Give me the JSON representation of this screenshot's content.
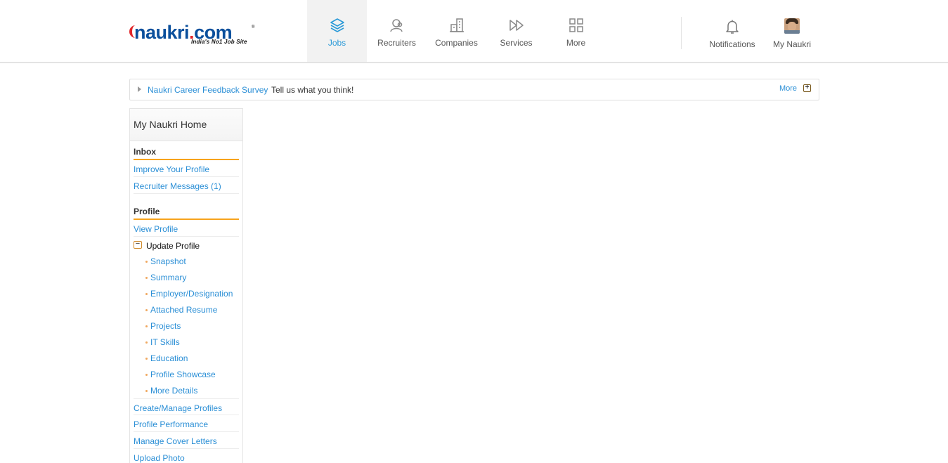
{
  "header": {
    "logo": {
      "name": "naukri",
      "dot": ".",
      "tld": "com",
      "tagline": "India's No1 Job Site",
      "reg": "®"
    },
    "nav": [
      {
        "label": "Jobs",
        "icon": "layers-icon",
        "active": true
      },
      {
        "label": "Recruiters",
        "icon": "recruiters-icon"
      },
      {
        "label": "Companies",
        "icon": "buildings-icon"
      },
      {
        "label": "Services",
        "icon": "fast-forward-icon"
      },
      {
        "label": "More",
        "icon": "grid-icon"
      }
    ],
    "notifications": {
      "label": "Notifications",
      "icon": "bell-icon"
    },
    "my_naukri": {
      "label": "My Naukri",
      "icon": "avatar"
    }
  },
  "survey": {
    "link": "Naukri Career Feedback Survey",
    "text": "Tell us what you think!",
    "more": "More",
    "plus": "+"
  },
  "sidebar": {
    "title": "My Naukri Home",
    "inbox": {
      "heading": "Inbox",
      "links": [
        "Improve Your Profile",
        "Recruiter Messages (1)"
      ]
    },
    "profile": {
      "heading": "Profile",
      "view": "View Profile",
      "update": {
        "toggle": "−",
        "label": "Update Profile"
      },
      "sub_links": [
        "Snapshot",
        "Summary",
        "Employer/Designation",
        "Attached Resume",
        "Projects",
        "IT Skills",
        "Education",
        "Profile Showcase",
        "More Details"
      ],
      "more_links": [
        "Create/Manage Profiles",
        "Profile Performance",
        "Manage Cover Letters",
        "Upload Photo"
      ]
    }
  },
  "colors": {
    "accent": "#2b9ad8",
    "link": "#2b8fd6",
    "section_rule": "#f7a31c"
  }
}
